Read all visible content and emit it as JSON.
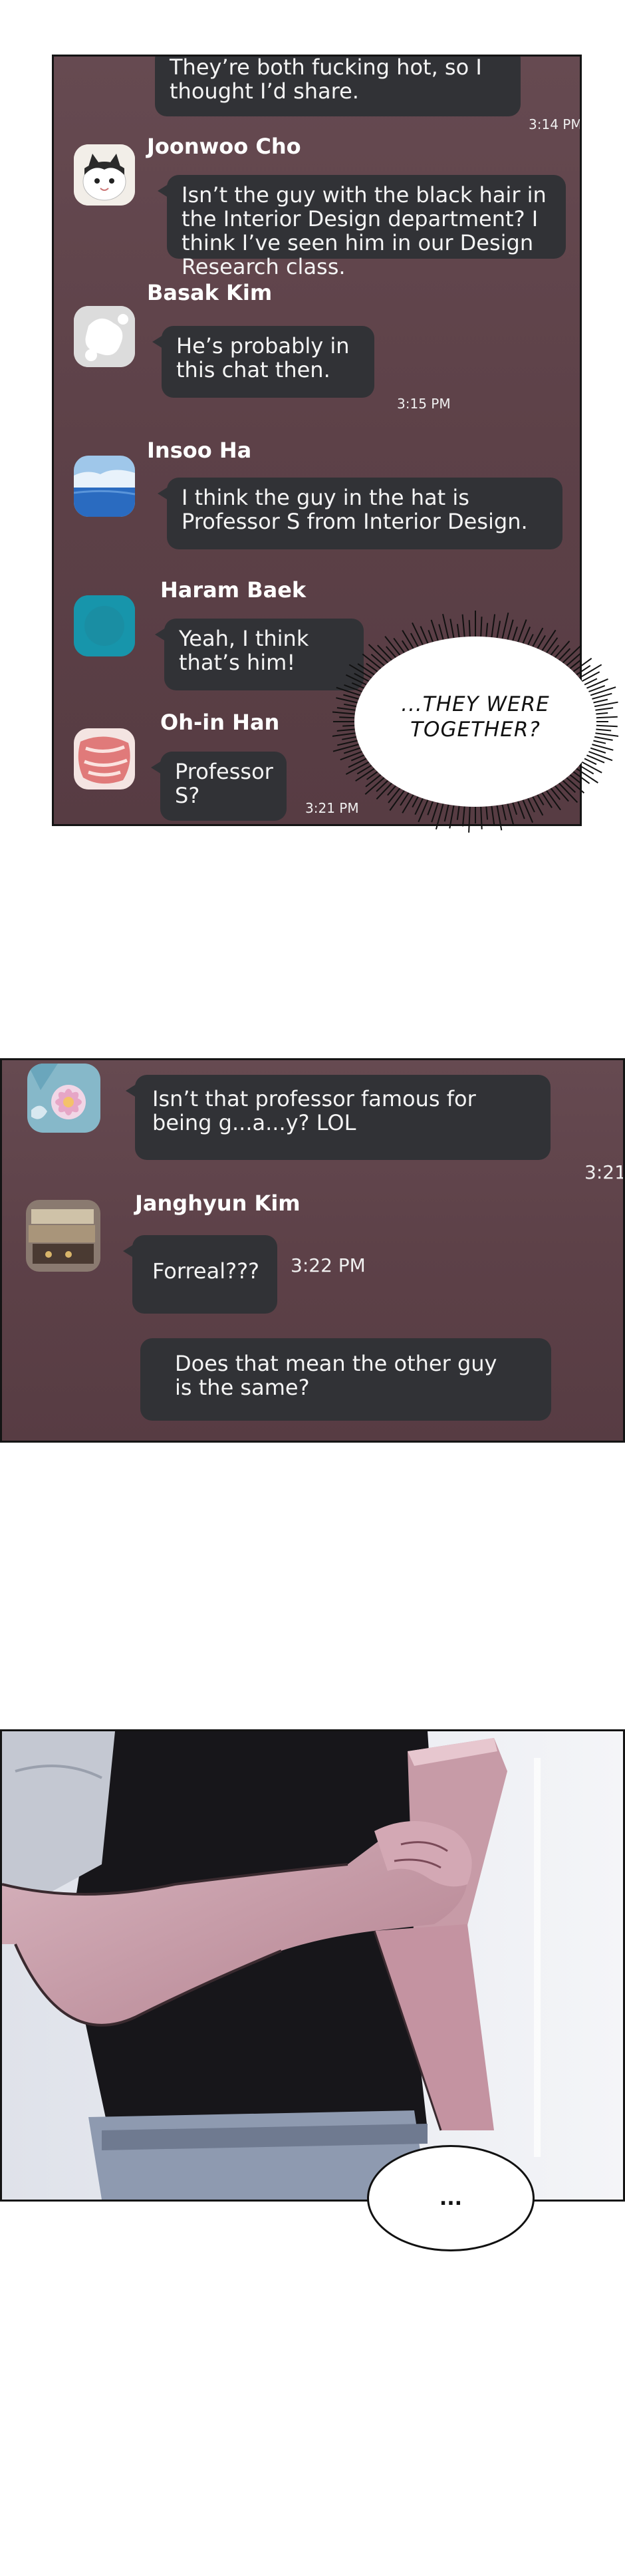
{
  "panel1": {
    "messages": [
      {
        "text": "They’re both fucking hot, so I thought I’d share.",
        "time": "3:14 PM"
      },
      {
        "name": "Joonwoo Cho",
        "text": "Isn’t the guy with the black hair in the Interior Design department? I think I’ve seen him in our Design Research class."
      },
      {
        "name": "Basak Kim",
        "text": "He’s probably in this chat then.",
        "time": "3:15 PM"
      },
      {
        "name": "Insoo Ha",
        "text": "I think the guy in the hat is Professor S from Interior Design."
      },
      {
        "name": "Haram Baek",
        "text": "Yeah, I think that’s him!"
      },
      {
        "name": "Oh-in Han",
        "text": "Professor S?",
        "time": "3:21 PM"
      }
    ],
    "speech": "...THEY WERE TOGETHER?"
  },
  "panel2": {
    "messages": [
      {
        "text": "Isn’t that professor famous for being g...a...y? LOL",
        "time": "3:21"
      },
      {
        "name": "Janghyun Kim",
        "text": "Forreal???",
        "time": "3:22 PM"
      },
      {
        "text": "Does that mean the other guy is the same?"
      }
    ]
  },
  "panel3": {
    "speech": "..."
  },
  "colors": {
    "chat_bg": "#5f434a",
    "bubble": "#313236",
    "skin": "#c99aa6",
    "shirt": "#17161a"
  }
}
